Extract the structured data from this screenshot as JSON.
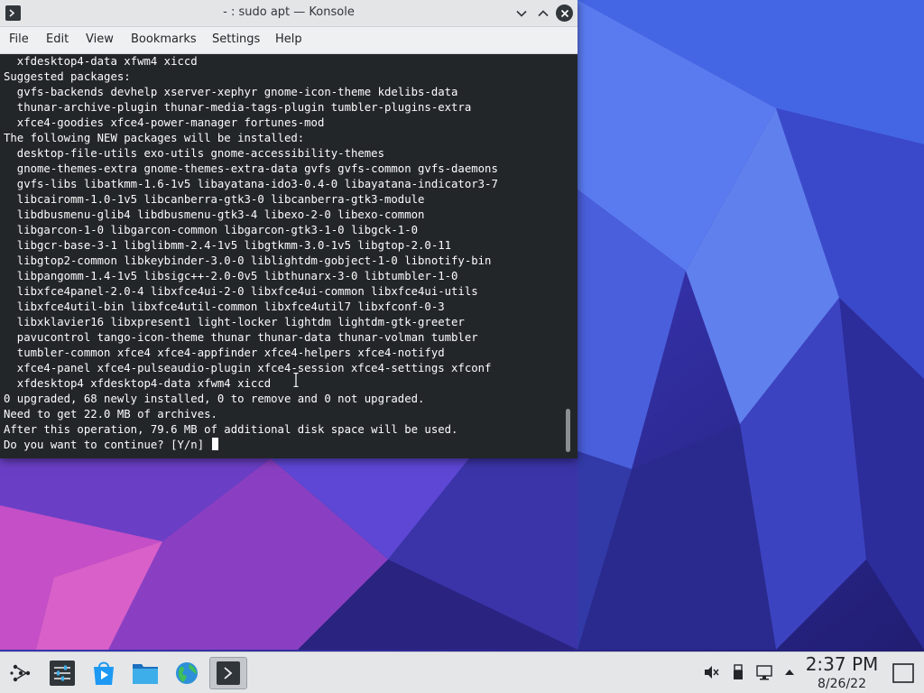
{
  "window": {
    "title": "- : sudo apt — Konsole",
    "menu": [
      "File",
      "Edit",
      "View",
      "Bookmarks",
      "Settings",
      "Help"
    ]
  },
  "terminal": {
    "lines": [
      "  xfdesktop4-data xfwm4 xiccd",
      "Suggested packages:",
      "  gvfs-backends devhelp xserver-xephyr gnome-icon-theme kdelibs-data",
      "  thunar-archive-plugin thunar-media-tags-plugin tumbler-plugins-extra",
      "  xfce4-goodies xfce4-power-manager fortunes-mod",
      "The following NEW packages will be installed:",
      "  desktop-file-utils exo-utils gnome-accessibility-themes",
      "  gnome-themes-extra gnome-themes-extra-data gvfs gvfs-common gvfs-daemons",
      "  gvfs-libs libatkmm-1.6-1v5 libayatana-ido3-0.4-0 libayatana-indicator3-7",
      "  libcairomm-1.0-1v5 libcanberra-gtk3-0 libcanberra-gtk3-module",
      "  libdbusmenu-glib4 libdbusmenu-gtk3-4 libexo-2-0 libexo-common",
      "  libgarcon-1-0 libgarcon-common libgarcon-gtk3-1-0 libgck-1-0",
      "  libgcr-base-3-1 libglibmm-2.4-1v5 libgtkmm-3.0-1v5 libgtop-2.0-11",
      "  libgtop2-common libkeybinder-3.0-0 liblightdm-gobject-1-0 libnotify-bin",
      "  libpangomm-1.4-1v5 libsigc++-2.0-0v5 libthunarx-3-0 libtumbler-1-0",
      "  libxfce4panel-2.0-4 libxfce4ui-2-0 libxfce4ui-common libxfce4ui-utils",
      "  libxfce4util-bin libxfce4util-common libxfce4util7 libxfconf-0-3",
      "  libxklavier16 libxpresent1 light-locker lightdm lightdm-gtk-greeter",
      "  pavucontrol tango-icon-theme thunar thunar-data thunar-volman tumbler",
      "  tumbler-common xfce4 xfce4-appfinder xfce4-helpers xfce4-notifyd",
      "  xfce4-panel xfce4-pulseaudio-plugin xfce4-session xfce4-settings xfconf",
      "  xfdesktop4 xfdesktop4-data xfwm4 xiccd",
      "0 upgraded, 68 newly installed, 0 to remove and 0 not upgraded.",
      "Need to get 22.0 MB of archives.",
      "After this operation, 79.6 MB of additional disk space will be used."
    ],
    "prompt": "Do you want to continue? [Y/n] "
  },
  "panel": {
    "time": "2:37 PM",
    "date": "8/26/22"
  },
  "colors": {
    "terminal_bg": "#232629",
    "terminal_fg": "#fcfcfc",
    "titlebar_bg": "#e3e5e7",
    "panel_bg": "#e4e6e8"
  },
  "icons": {
    "launchers": [
      "application-launcher-icon",
      "system-settings-icon",
      "discover-store-icon",
      "file-manager-icon",
      "web-browser-icon",
      "konsole-icon"
    ],
    "tray": [
      "volume-muted-icon",
      "usb-device-icon",
      "network-icon",
      "tray-expand-icon",
      "show-desktop-icon"
    ]
  }
}
